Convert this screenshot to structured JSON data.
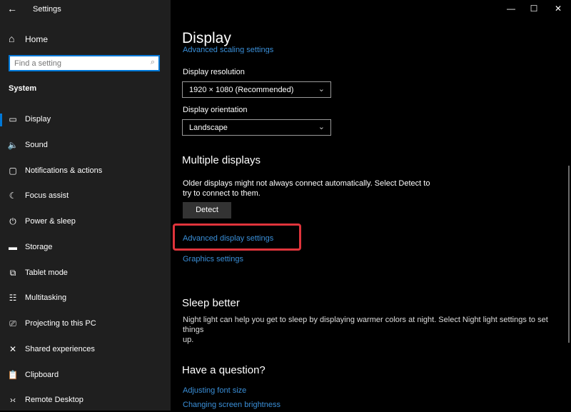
{
  "window": {
    "title": "Settings",
    "controls": {
      "minimize": "—",
      "maximize": "☐",
      "close": "✕"
    }
  },
  "sidebar": {
    "back_icon": "←",
    "home": {
      "icon": "⌂",
      "label": "Home"
    },
    "search": {
      "placeholder": "Find a setting",
      "value": "",
      "icon": "⌕"
    },
    "section": "System",
    "items": [
      {
        "icon": "▭",
        "label": "Display",
        "active": true
      },
      {
        "icon": "🔈",
        "label": "Sound"
      },
      {
        "icon": "▢",
        "label": "Notifications & actions"
      },
      {
        "icon": "☾",
        "label": "Focus assist"
      },
      {
        "icon": "⏻",
        "label": "Power & sleep"
      },
      {
        "icon": "▬",
        "label": "Storage"
      },
      {
        "icon": "⧉",
        "label": "Tablet mode"
      },
      {
        "icon": "☷",
        "label": "Multitasking"
      },
      {
        "icon": "⎚",
        "label": "Projecting to this PC"
      },
      {
        "icon": "✕",
        "label": "Shared experiences"
      },
      {
        "icon": "📋",
        "label": "Clipboard"
      },
      {
        "icon": "›‹",
        "label": "Remote Desktop"
      }
    ]
  },
  "main": {
    "title": "Display",
    "clipped_link": "Advanced scaling settings",
    "resolution": {
      "label": "Display resolution",
      "value": "1920 × 1080 (Recommended)",
      "chevron": "⌄"
    },
    "orientation": {
      "label": "Display orientation",
      "value": "Landscape",
      "chevron": "⌄"
    },
    "multiple_displays": {
      "heading": "Multiple displays",
      "text_line1": "Older displays might not always connect automatically. Select Detect to",
      "text_line2": "try to connect to them.",
      "detect_button": "Detect",
      "advanced_link": "Advanced display settings",
      "graphics_link": "Graphics settings"
    },
    "sleep_better": {
      "heading": "Sleep better",
      "text_line1": "Night light can help you get to sleep by displaying warmer colors at night. Select Night light settings to set things",
      "text_line2": "up."
    },
    "question": {
      "heading": "Have a question?",
      "links": [
        "Adjusting font size",
        "Changing screen brightness"
      ]
    }
  },
  "colors": {
    "accent": "#0078d7",
    "link": "#3a8fd8",
    "highlight": "#e0343b",
    "sidebar_bg": "#1f1f1f",
    "main_bg": "#000000"
  }
}
